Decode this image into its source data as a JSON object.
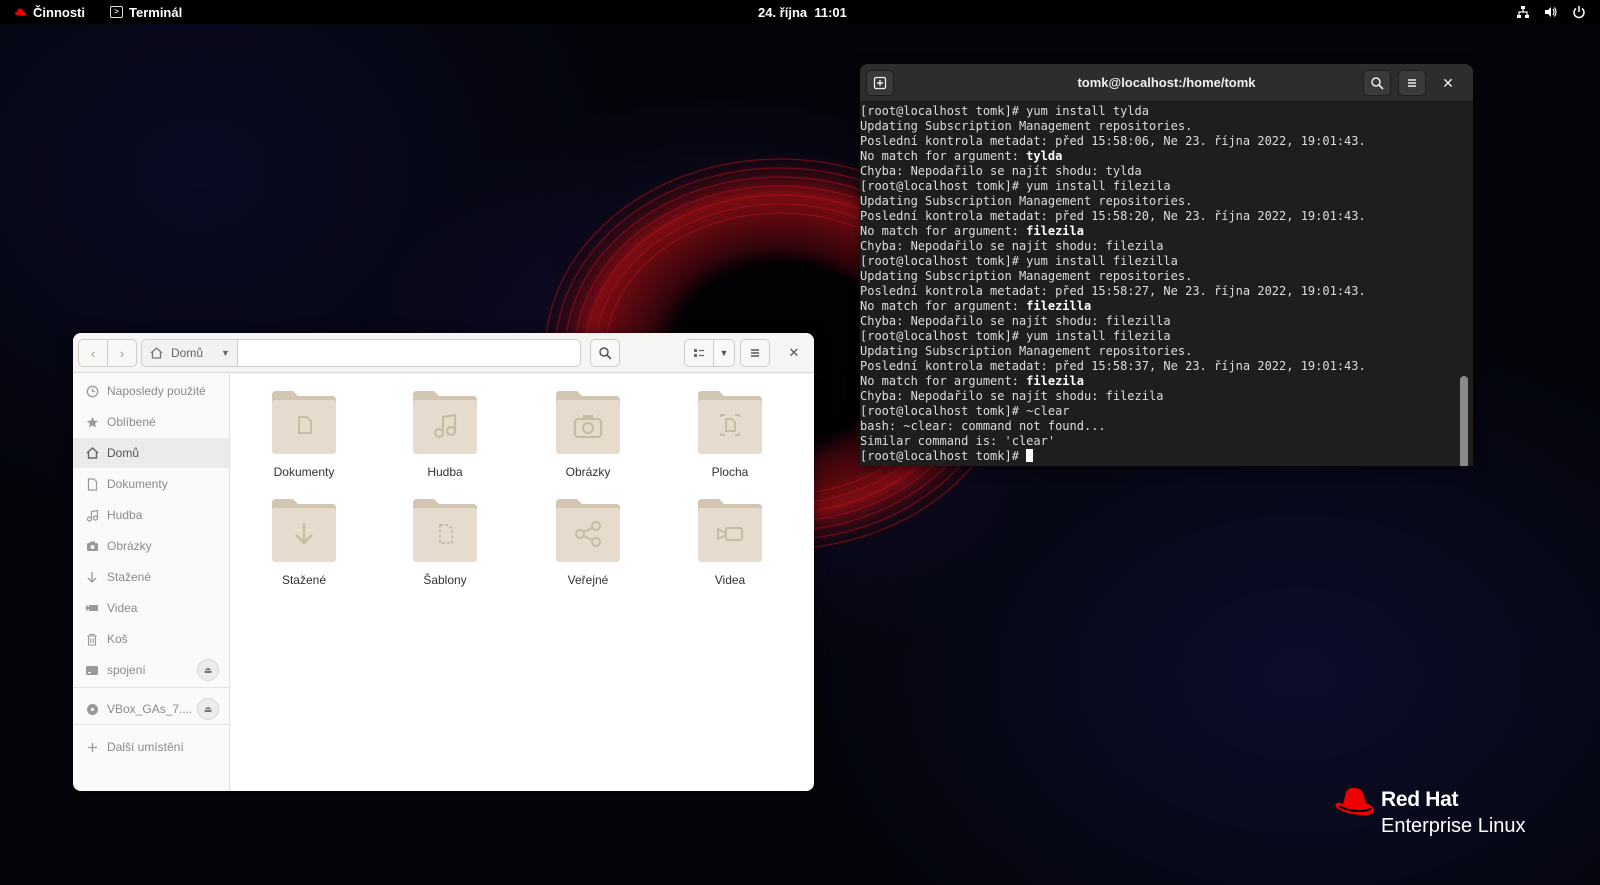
{
  "topbar": {
    "activities_label": "Činnosti",
    "app_label": "Terminál",
    "clock": "24. října  11:01",
    "tray_icons": [
      "network-icon",
      "volume-icon",
      "power-icon"
    ]
  },
  "terminal": {
    "title": "tomk@localhost:/home/tomk",
    "lines": [
      {
        "text": "[root@localhost tomk]# yum install tylda",
        "bold": ""
      },
      {
        "text": "Updating Subscription Management repositories.",
        "bold": ""
      },
      {
        "text": "Poslední kontrola metadat: před 15:58:06, Ne 23. října 2022, 19:01:43.",
        "bold": ""
      },
      {
        "text": "No match for argument: ",
        "bold": "tylda"
      },
      {
        "text": "Chyba: Nepodařilo se najít shodu: tylda",
        "bold": ""
      },
      {
        "text": "[root@localhost tomk]# yum install filezila",
        "bold": ""
      },
      {
        "text": "Updating Subscription Management repositories.",
        "bold": ""
      },
      {
        "text": "Poslední kontrola metadat: před 15:58:20, Ne 23. října 2022, 19:01:43.",
        "bold": ""
      },
      {
        "text": "No match for argument: ",
        "bold": "filezila"
      },
      {
        "text": "Chyba: Nepodařilo se najít shodu: filezila",
        "bold": ""
      },
      {
        "text": "[root@localhost tomk]# yum install filezilla",
        "bold": ""
      },
      {
        "text": "Updating Subscription Management repositories.",
        "bold": ""
      },
      {
        "text": "Poslední kontrola metadat: před 15:58:27, Ne 23. října 2022, 19:01:43.",
        "bold": ""
      },
      {
        "text": "No match for argument: ",
        "bold": "filezilla"
      },
      {
        "text": "Chyba: Nepodařilo se najít shodu: filezilla",
        "bold": ""
      },
      {
        "text": "[root@localhost tomk]# yum install filezila",
        "bold": ""
      },
      {
        "text": "Updating Subscription Management repositories.",
        "bold": ""
      },
      {
        "text": "Poslední kontrola metadat: před 15:58:37, Ne 23. října 2022, 19:01:43.",
        "bold": ""
      },
      {
        "text": "No match for argument: ",
        "bold": "filezila"
      },
      {
        "text": "Chyba: Nepodařilo se najít shodu: filezila",
        "bold": ""
      },
      {
        "text": "[root@localhost tomk]# ~clear",
        "bold": ""
      },
      {
        "text": "bash: ~clear: command not found...",
        "bold": ""
      },
      {
        "text": "Similar command is: 'clear'",
        "bold": ""
      }
    ],
    "prompt": "[root@localhost tomk]# "
  },
  "files": {
    "path_current": "Domů",
    "sidebar": [
      {
        "label": "Naposledy použité",
        "icon": "clock-icon"
      },
      {
        "label": "Oblíbené",
        "icon": "star-icon"
      },
      {
        "label": "Domů",
        "icon": "home-icon"
      },
      {
        "label": "Dokumenty",
        "icon": "document-icon"
      },
      {
        "label": "Hudba",
        "icon": "music-icon"
      },
      {
        "label": "Obrázky",
        "icon": "camera-icon"
      },
      {
        "label": "Stažené",
        "icon": "download-icon"
      },
      {
        "label": "Videa",
        "icon": "video-icon"
      },
      {
        "label": "Koš",
        "icon": "trash-icon"
      },
      {
        "label": "spojení",
        "icon": "drive-icon"
      },
      {
        "label": "VBox_GAs_7....",
        "icon": "disc-icon"
      },
      {
        "label": "Další umístění",
        "icon": "plus-icon"
      }
    ],
    "folders": [
      {
        "label": "Dokumenty",
        "icon": "document-icon"
      },
      {
        "label": "Hudba",
        "icon": "music-icon"
      },
      {
        "label": "Obrázky",
        "icon": "camera-icon"
      },
      {
        "label": "Plocha",
        "icon": "desktop-icon"
      },
      {
        "label": "Stažené",
        "icon": "download-icon"
      },
      {
        "label": "Šablony",
        "icon": "template-icon"
      },
      {
        "label": "Veřejné",
        "icon": "share-icon"
      },
      {
        "label": "Videa",
        "icon": "video-icon"
      }
    ]
  },
  "brand": {
    "line1": "Red Hat",
    "line2": "Enterprise Linux",
    "color": "#ee0000"
  }
}
